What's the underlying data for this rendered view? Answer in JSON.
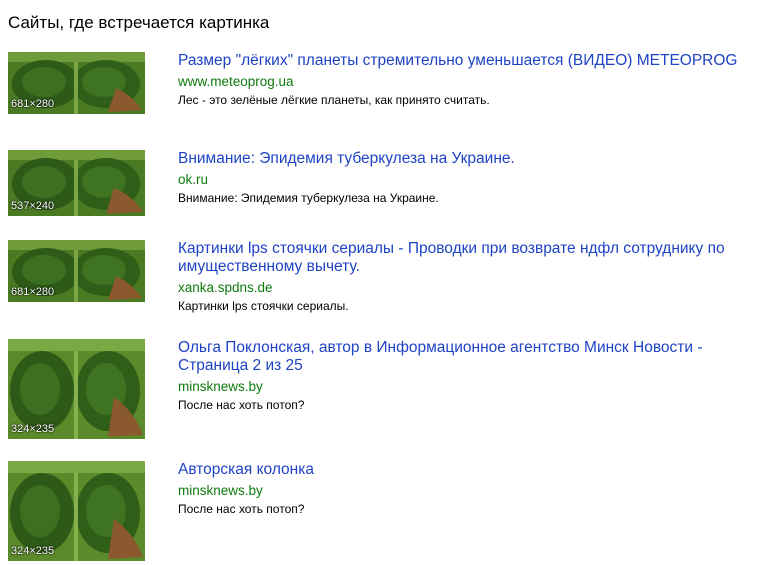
{
  "header": {
    "title": "Сайты, где встречается картинка"
  },
  "results": [
    {
      "title": "Размер \"лёгких\" планеты стремительно уменьшается (ВИДЕО) METEOPROG",
      "url": "www.meteoprog.ua",
      "snippet": "Лес - это зелёные лёгкие планеты, как принято считать.",
      "size": "681×280"
    },
    {
      "title": "Внимание: Эпидемия туберкулеза на Украине.",
      "url": "ok.ru",
      "snippet": "Внимание: Эпидемия туберкулеза на Украине.",
      "size": "537×240"
    },
    {
      "title": "Картинки lps стоячки сериалы - Проводки при возврате ндфл сотруднику по имущественному вычету.",
      "url": "xanka.spdns.de",
      "snippet": "Картинки lps стоячки сериалы.",
      "size": "681×280"
    },
    {
      "title": "Ольга Поклонская, автор в Информационное агентство Минск Новости - Страница 2 из 25",
      "url": "minsknews.by",
      "snippet": "После нас хоть потоп?",
      "size": "324×235"
    },
    {
      "title": "Авторская колонка",
      "url": "minsknews.by",
      "snippet": "После нас хоть потоп?",
      "size": "324×235"
    }
  ]
}
